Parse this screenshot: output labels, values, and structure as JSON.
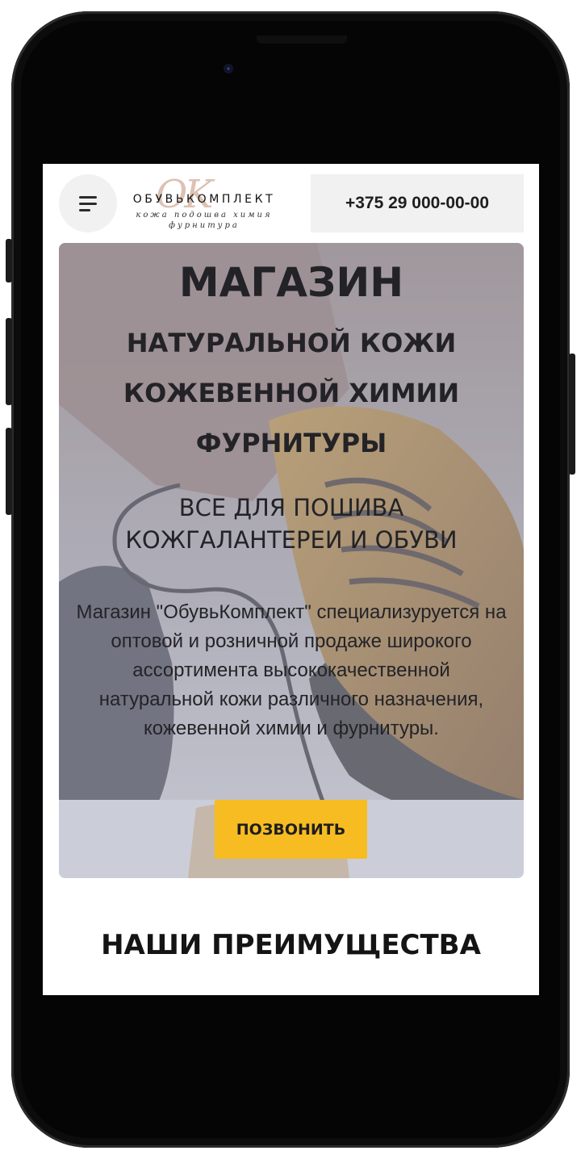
{
  "header": {
    "menu_icon": "hamburger-menu-icon",
    "logo": {
      "monogram": "OK",
      "name": "ОБУВЬКОМПЛЕКТ",
      "tagline_line1": "кожа подошва химия",
      "tagline_line2": "фурнитура"
    },
    "phone": "+375 29 000-00-00"
  },
  "hero": {
    "title": "МАГАЗИН",
    "subtitle_lines": [
      "НАТУРАЛЬНОЙ КОЖИ",
      "КОЖЕВЕННОЙ ХИМИИ",
      "ФУРНИТУРЫ"
    ],
    "tagline_lines": [
      "ВСЕ ДЛЯ ПОШИВА",
      "КОЖГАЛАНТЕРЕИ И ОБУВИ"
    ],
    "description": "Магазин \"ОбувьКомплект\" специализуруется на оптовой и розничной продаже широкого ассортимента высококачественной натуральной кожи различного назначения, кожевенной химии и фурнитуры.",
    "call_button": "ПОЗВОНИТЬ",
    "colors": {
      "button": "#f7bc22",
      "overlay": "#b9bed2"
    }
  },
  "advantages": {
    "title": "НАШИ ПРЕИМУЩЕСТВА"
  }
}
